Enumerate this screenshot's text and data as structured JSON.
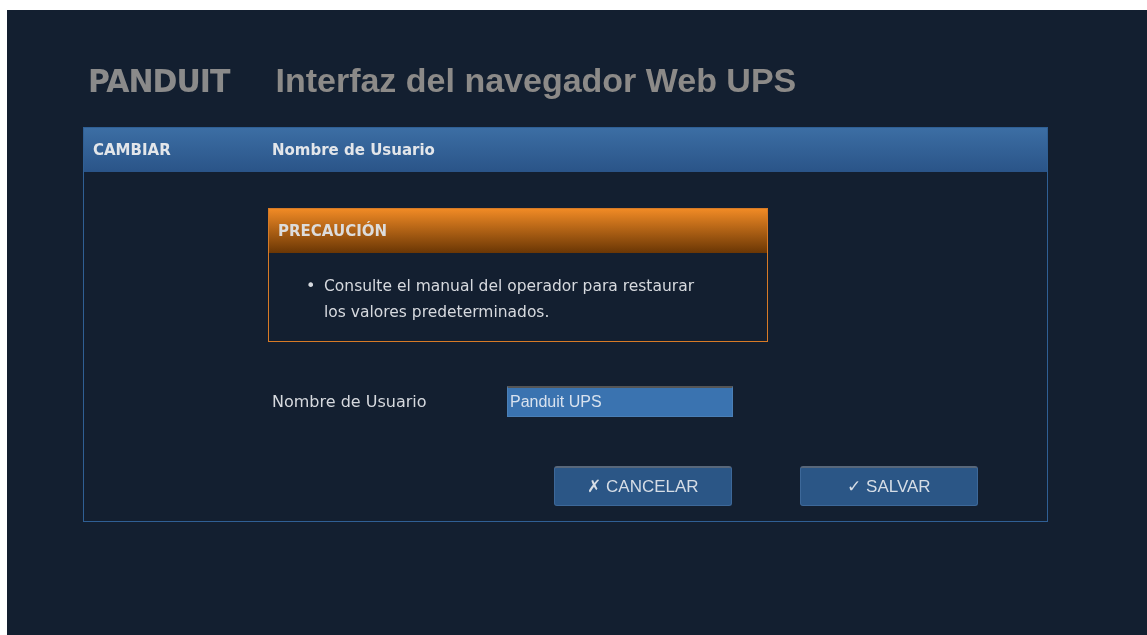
{
  "header": {
    "logo": "PANDUIT",
    "title": "Interfaz del navegador Web UPS"
  },
  "panel": {
    "section": "CAMBIAR",
    "heading": "Nombre de Usuario"
  },
  "caution": {
    "title": "PRECAUCIÓN",
    "items": [
      {
        "bullet": "•",
        "text": "Consulte el manual del operador para restaurar los valores predeterminados."
      }
    ]
  },
  "field": {
    "label": "Nombre de Usuario",
    "value": "Panduit UPS"
  },
  "buttons": [
    "✗ CANCELAR",
    "✓ SALVAR"
  ]
}
